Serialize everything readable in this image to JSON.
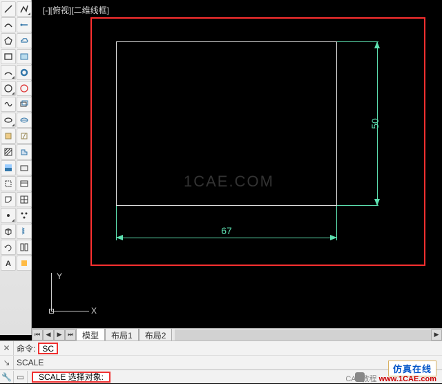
{
  "view_label": "[-][俯视][二维线框]",
  "dimensions": {
    "width": "67",
    "height": "50"
  },
  "ucs": {
    "x": "X",
    "y": "Y"
  },
  "watermark": "1CAE.COM",
  "tabs": {
    "model": "模型",
    "layout1": "布局1",
    "layout2": "布局2"
  },
  "command": {
    "line1_label": "命令:",
    "line1_input": "SC",
    "line2_text": "SCALE",
    "line3_text": "SCALE 选择对象:"
  },
  "badges": {
    "site_cn": "仿真在线",
    "caption_grey": "CAD教程",
    "caption_red": "www.1CAE.com"
  },
  "tool_icons": [
    "line",
    "pline",
    "circle-dropdown",
    "rect",
    "arc-dropdown",
    "ellipse",
    "spline",
    "polygon",
    "hatch",
    "point",
    "region",
    "curve1",
    "curve2",
    "spiral",
    "block",
    "revcloud",
    "donut",
    "ellipse-arc",
    "table",
    "3dface",
    "wipeout",
    "table2",
    "gradient",
    "ray",
    "helix",
    "constr",
    "mirror",
    "rect2",
    "polyline2",
    "text",
    "mtext",
    "blockref",
    "notes",
    "rotate",
    "stretch",
    "dim"
  ]
}
